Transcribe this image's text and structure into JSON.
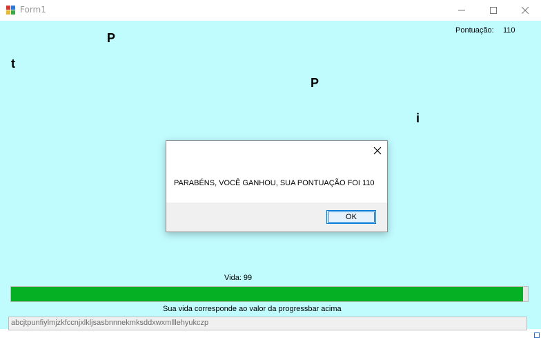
{
  "window": {
    "title": "Form1",
    "icon": "winforms-app-icon",
    "controls": {
      "minimize": "minimize-icon",
      "maximize": "maximize-icon",
      "close": "close-icon"
    }
  },
  "game": {
    "score_label": "Pontuação:",
    "score_value": "110",
    "falling_letters": [
      "P",
      "t",
      "P",
      "i"
    ],
    "life_label": "Vida: 99",
    "life_value": 99,
    "life_max": 100,
    "life_caption": "Sua vida corresponde ao valor da progressbar acima",
    "typed_text": "abcjtpunfiylmjzkfccnjxlkljsasbnnnekmksddxwxmlllehyukczp"
  },
  "dialog": {
    "message": "PARABÉNS, VOCÊ GANHOU, SUA PONTUAÇÃO FOI 110",
    "ok_label": "OK"
  },
  "colors": {
    "client_background": "#c0fbfe",
    "progress_fill": "#06b025"
  }
}
